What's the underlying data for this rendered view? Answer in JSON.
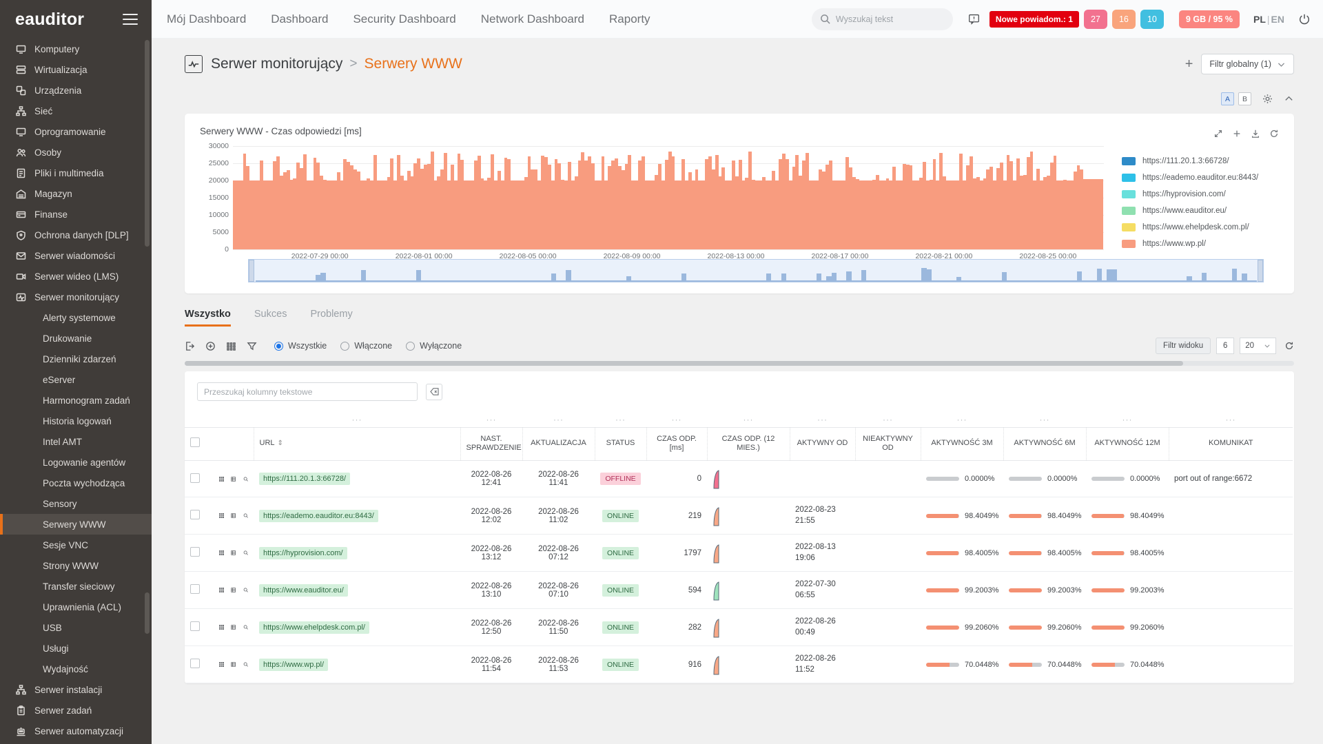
{
  "brand": {
    "logo": "eauditor",
    "menu_icon": "hamburger-icon"
  },
  "sidebar": {
    "items": [
      {
        "label": "Komputery",
        "icon": "monitor-icon",
        "level": 0
      },
      {
        "label": "Wirtualizacja",
        "icon": "servers-icon",
        "level": 0
      },
      {
        "label": "Urządzenia",
        "icon": "devices-icon",
        "level": 0
      },
      {
        "label": "Sieć",
        "icon": "network-icon",
        "level": 0
      },
      {
        "label": "Oprogramowanie",
        "icon": "monitor-icon",
        "level": 0
      },
      {
        "label": "Osoby",
        "icon": "people-icon",
        "level": 0
      },
      {
        "label": "Pliki i multimedia",
        "icon": "files-icon",
        "level": 0
      },
      {
        "label": "Magazyn",
        "icon": "warehouse-icon",
        "level": 0
      },
      {
        "label": "Finanse",
        "icon": "card-icon",
        "level": 0
      },
      {
        "label": "Ochrona danych [DLP]",
        "icon": "shield-icon",
        "level": 0
      },
      {
        "label": "Serwer wiadomości",
        "icon": "mail-icon",
        "level": 0
      },
      {
        "label": "Serwer wideo (LMS)",
        "icon": "video-icon",
        "level": 0
      },
      {
        "label": "Serwer monitorujący",
        "icon": "pulse-icon",
        "level": 0
      },
      {
        "label": "Alerty systemowe",
        "icon": "",
        "level": 1
      },
      {
        "label": "Drukowanie",
        "icon": "",
        "level": 1
      },
      {
        "label": "Dzienniki zdarzeń",
        "icon": "",
        "level": 1
      },
      {
        "label": "eServer",
        "icon": "",
        "level": 1
      },
      {
        "label": "Harmonogram zadań",
        "icon": "",
        "level": 1
      },
      {
        "label": "Historia logowań",
        "icon": "",
        "level": 1
      },
      {
        "label": "Intel AMT",
        "icon": "",
        "level": 1
      },
      {
        "label": "Logowanie agentów",
        "icon": "",
        "level": 1
      },
      {
        "label": "Poczta wychodząca",
        "icon": "",
        "level": 1
      },
      {
        "label": "Sensory",
        "icon": "",
        "level": 1
      },
      {
        "label": "Serwery WWW",
        "icon": "",
        "level": 1,
        "active": true
      },
      {
        "label": "Sesje VNC",
        "icon": "",
        "level": 1
      },
      {
        "label": "Strony WWW",
        "icon": "",
        "level": 1
      },
      {
        "label": "Transfer sieciowy",
        "icon": "",
        "level": 1
      },
      {
        "label": "Uprawnienia (ACL)",
        "icon": "",
        "level": 1
      },
      {
        "label": "USB",
        "icon": "",
        "level": 1
      },
      {
        "label": "Usługi",
        "icon": "",
        "level": 1
      },
      {
        "label": "Wydajność",
        "icon": "",
        "level": 1
      },
      {
        "label": "Serwer instalacji",
        "icon": "network-icon",
        "level": 0
      },
      {
        "label": "Serwer zadań",
        "icon": "clipboard-icon",
        "level": 0
      },
      {
        "label": "Serwer automatyzacji",
        "icon": "robot-icon",
        "level": 0
      }
    ]
  },
  "topbar": {
    "nav": [
      "Mój Dashboard",
      "Dashboard",
      "Security Dashboard",
      "Network Dashboard",
      "Raporty"
    ],
    "search_placeholder": "Wyszukaj tekst",
    "search_value": "",
    "alert_icon": "notification-icon",
    "notification_badge": "Nowe powiadom.: 1",
    "counters": [
      {
        "value": "27",
        "color": "#f2718f"
      },
      {
        "value": "16",
        "color": "#f9a47c"
      },
      {
        "value": "10",
        "color": "#41bfe0"
      }
    ],
    "memory_badge": "9 GB / 95 %",
    "memory_color": "#fb8580",
    "lang_pl": "PL",
    "lang_sep": "|",
    "lang_en": "EN",
    "power_icon": "power-icon"
  },
  "breadcrumb": {
    "icon": "pulse-icon",
    "parent": "Serwer monitorujący",
    "separator": ">",
    "current": "Serwery WWW",
    "add_label": "+",
    "global_filter": "Filtr globalny (1)",
    "accent": "#e8711a"
  },
  "panel_tools": {
    "a_label": "A",
    "b_label": "B",
    "gear_icon": "gear-icon",
    "collapse_icon": "chevron-up-icon"
  },
  "chart_card": {
    "title": "Serwery WWW - Czas odpowiedzi [ms]",
    "icons": [
      "expand-icon",
      "plus-icon",
      "download-icon",
      "refresh-icon"
    ]
  },
  "chart_data": {
    "type": "area",
    "title": "Serwery WWW - Czas odpowiedzi [ms]",
    "xlabel": "",
    "ylabel": "Czas odpowiedzi [ms]",
    "ylim": [
      0,
      30000
    ],
    "yticks": [
      0,
      5000,
      10000,
      15000,
      20000,
      25000,
      30000
    ],
    "xticks": [
      "2022-07-29 00:00",
      "2022-08-01 00:00",
      "2022-08-05 00:00",
      "2022-08-09 00:00",
      "2022-08-13 00:00",
      "2022-08-17 00:00",
      "2022-08-21 00:00",
      "2022-08-25 00:00"
    ],
    "grid": true,
    "legend_position": "right",
    "series": [
      {
        "name": "https://111.20.1.3:66728/",
        "color": "#2e8bc8"
      },
      {
        "name": "https://eademo.eauditor.eu:8443/",
        "color": "#2ec0e8"
      },
      {
        "name": "https://hyprovision.com/",
        "color": "#68e0dc"
      },
      {
        "name": "https://www.eauditor.eu/",
        "color": "#8fe0b0"
      },
      {
        "name": "https://www.ehelpdesk.com.pl/",
        "color": "#f5dd63"
      },
      {
        "name": "https://www.wp.pl/",
        "color": "#f89c7f"
      }
    ],
    "stacked_total_note": "Stacked area, dominant series https://www.wp.pl/ around 20000-27000 ms",
    "baseline_value": 20000,
    "peak_value": 27000
  },
  "tabs": [
    {
      "label": "Wszystko",
      "active": true
    },
    {
      "label": "Sukces",
      "active": false
    },
    {
      "label": "Problemy",
      "active": false
    }
  ],
  "table_toolbar": {
    "icons": [
      "export-icon",
      "add-circle-icon",
      "grid-icon",
      "filter-icon"
    ],
    "radios": [
      {
        "label": "Wszystkie",
        "checked": true
      },
      {
        "label": "Włączone",
        "checked": false
      },
      {
        "label": "Wyłączone",
        "checked": false
      }
    ],
    "view_filter": "Filtr widoku",
    "filter_count": "6",
    "page_size": "20",
    "refresh_icon": "refresh-icon"
  },
  "table": {
    "search_placeholder": "Przeszukaj kolumny tekstowe",
    "clear_icon": "clear-icon",
    "columns": [
      "URL",
      "NAST. SPRAWDZENIE",
      "AKTUALIZACJA",
      "STATUS",
      "CZAS ODP. [ms]",
      "CZAS ODP. (12 MIES.)",
      "AKTYWNY OD",
      "NIEAKTYWNY OD",
      "AKTYWNOŚĆ 3M",
      "AKTYWNOŚĆ 6M",
      "AKTYWNOŚĆ 12M",
      "KOMUNIKAT"
    ],
    "sort_column": "URL",
    "rows": [
      {
        "url": "https://111.20.1.3:66728/",
        "next_check": "2022-08-26 12:41",
        "update": "2022-08-26 11:41",
        "status": "OFFLINE",
        "resp_ms": "0",
        "active_from": "",
        "inactive_from": "",
        "act3m": "0.0000%",
        "act6m": "0.0000%",
        "act12m": "0.0000%",
        "act_pct": 0,
        "bar_color": "#ee6e92",
        "spark_color": "#f2718f",
        "message": "port out of range:6672"
      },
      {
        "url": "https://eademo.eauditor.eu:8443/",
        "next_check": "2022-08-26 12:02",
        "update": "2022-08-26 11:02",
        "status": "ONLINE",
        "resp_ms": "219",
        "active_from": "2022-08-23 21:55",
        "inactive_from": "",
        "act3m": "98.4049%",
        "act6m": "98.4049%",
        "act12m": "98.4049%",
        "act_pct": 98.4,
        "bar_color": "#f49072",
        "spark_color": "#f8a887",
        "message": ""
      },
      {
        "url": "https://hyprovision.com/",
        "next_check": "2022-08-26 13:12",
        "update": "2022-08-26 07:12",
        "status": "ONLINE",
        "resp_ms": "1797",
        "active_from": "2022-08-13 19:06",
        "inactive_from": "",
        "act3m": "98.4005%",
        "act6m": "98.4005%",
        "act12m": "98.4005%",
        "act_pct": 98.4,
        "bar_color": "#f49072",
        "spark_color": "#f8a887",
        "message": ""
      },
      {
        "url": "https://www.eauditor.eu/",
        "next_check": "2022-08-26 13:10",
        "update": "2022-08-26 07:10",
        "status": "ONLINE",
        "resp_ms": "594",
        "active_from": "2022-07-30 06:55",
        "inactive_from": "",
        "act3m": "99.2003%",
        "act6m": "99.2003%",
        "act12m": "99.2003%",
        "act_pct": 99.2,
        "bar_color": "#f49072",
        "spark_color": "#9fe3bd",
        "message": ""
      },
      {
        "url": "https://www.ehelpdesk.com.pl/",
        "next_check": "2022-08-26 12:50",
        "update": "2022-08-26 11:50",
        "status": "ONLINE",
        "resp_ms": "282",
        "active_from": "2022-08-26 00:49",
        "inactive_from": "",
        "act3m": "99.2060%",
        "act6m": "99.2060%",
        "act12m": "99.2060%",
        "act_pct": 99.2,
        "bar_color": "#f49072",
        "spark_color": "#f8a887",
        "message": ""
      },
      {
        "url": "https://www.wp.pl/",
        "next_check": "2022-08-26 11:54",
        "update": "2022-08-26 11:53",
        "status": "ONLINE",
        "resp_ms": "916",
        "active_from": "2022-08-26 11:52",
        "inactive_from": "",
        "act3m": "70.0448%",
        "act6m": "70.0448%",
        "act12m": "70.0448%",
        "act_pct": 70,
        "bar_color": "#f49072",
        "spark_color": "#f8a887",
        "message": ""
      }
    ]
  }
}
